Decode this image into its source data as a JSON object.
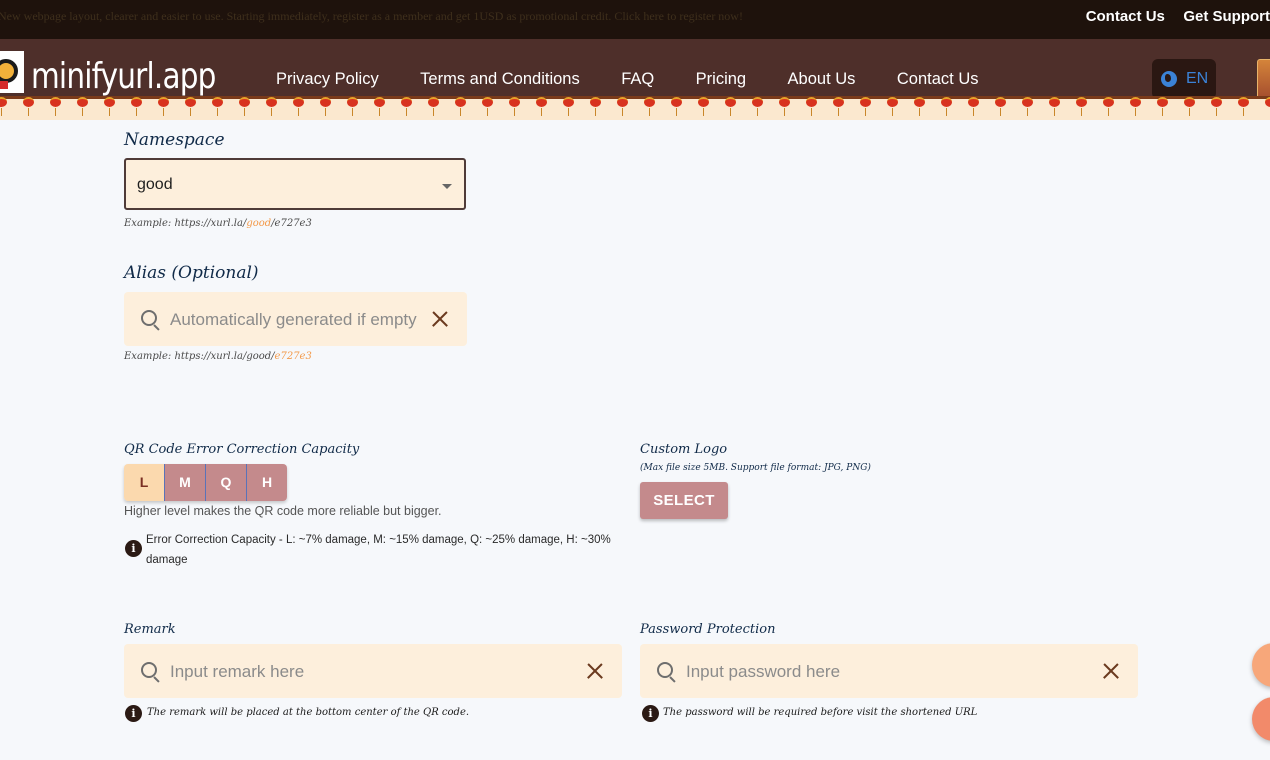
{
  "topbar": {
    "marquee": "New webpage layout, clearer and easier to use. Starting immediately, register as a member and get 1USD as promotional credit. Click here to register now!",
    "links": [
      "Contact Us",
      "Get Support"
    ]
  },
  "nav": {
    "logo": "minifyurl.app",
    "links": [
      "Privacy Policy",
      "Terms and Conditions",
      "FAQ",
      "Pricing",
      "About Us",
      "Contact Us"
    ],
    "language": "EN"
  },
  "form": {
    "namespace": {
      "label": "Namespace",
      "value": "good",
      "example_prefix": "Example: https://xurl.la/",
      "example_highlight": "good",
      "example_suffix": "/e727e3"
    },
    "alias": {
      "label": "Alias (Optional)",
      "placeholder": "Automatically generated if empty",
      "example_prefix": "Example: https://xurl.la/good/",
      "example_highlight": "e727e3"
    },
    "ecc": {
      "label": "QR Code Error Correction Capacity",
      "options": [
        "L",
        "M",
        "Q",
        "H"
      ],
      "selected": "L",
      "help": "Higher level makes the QR code more reliable but bigger.",
      "info": "Error Correction Capacity - L: ~7% damage, M: ~15% damage, Q: ~25% damage, H: ~30% damage"
    },
    "logo": {
      "label": "Custom Logo",
      "note": "(Max file size 5MB. Support file format: JPG, PNG)",
      "button": "SELECT"
    },
    "remark": {
      "label": "Remark",
      "placeholder": "Input remark here",
      "note": "The remark will be placed at the bottom center of the QR code."
    },
    "password": {
      "label": "Password Protection",
      "placeholder": "Input password here",
      "note": "The password will be required before visit the shortened URL"
    }
  },
  "colors": {
    "nav_bg": "#4e2f2a",
    "topbar_bg": "#1e120c",
    "field_bg": "#fdefdc",
    "accent_button": "#c48a8c",
    "accent_highlight": "#f39a4a"
  }
}
